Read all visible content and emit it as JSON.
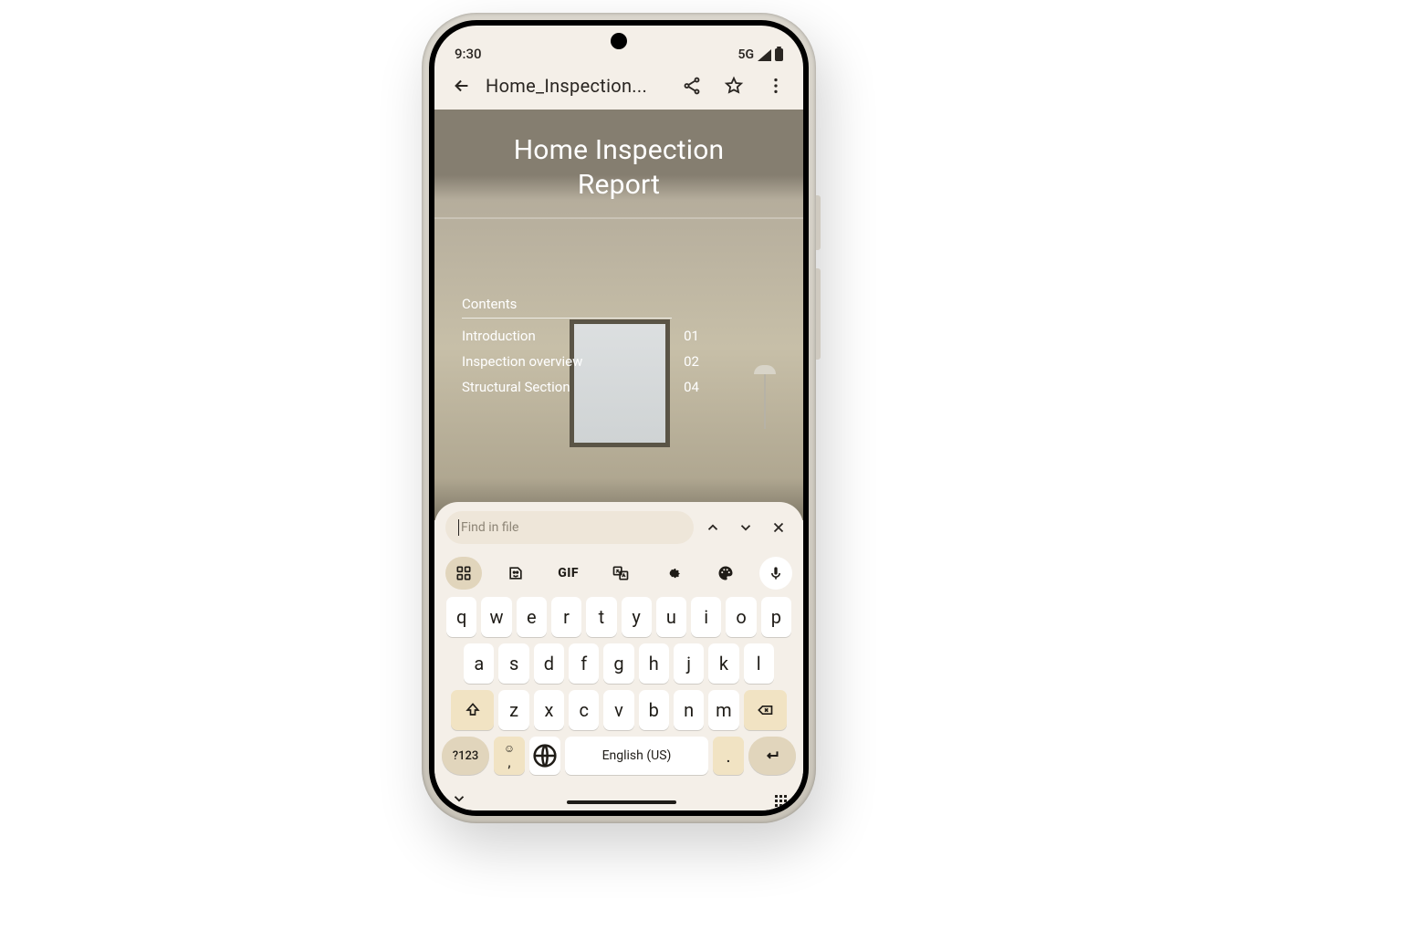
{
  "status": {
    "time": "9:30",
    "network": "5G"
  },
  "appbar": {
    "title": "Home_Inspection..."
  },
  "document": {
    "title_line1": "Home Inspection",
    "title_line2": "Report",
    "contents_label": "Contents",
    "toc": [
      {
        "label": "Introduction",
        "page": "01"
      },
      {
        "label": "Inspection overview",
        "page": "02"
      },
      {
        "label": "Structural Section",
        "page": "04"
      }
    ]
  },
  "find": {
    "placeholder": "Find in file"
  },
  "keyboard": {
    "gif_label": "GIF",
    "row1": [
      "q",
      "w",
      "e",
      "r",
      "t",
      "y",
      "u",
      "i",
      "o",
      "p"
    ],
    "row2": [
      "a",
      "s",
      "d",
      "f",
      "g",
      "h",
      "j",
      "k",
      "l"
    ],
    "row3": [
      "z",
      "x",
      "c",
      "v",
      "b",
      "n",
      "m"
    ],
    "symbols_label": "?123",
    "emoji_top": "☺",
    "emoji_bottom": ",",
    "space_label": "English (US)",
    "dot_label": "."
  }
}
